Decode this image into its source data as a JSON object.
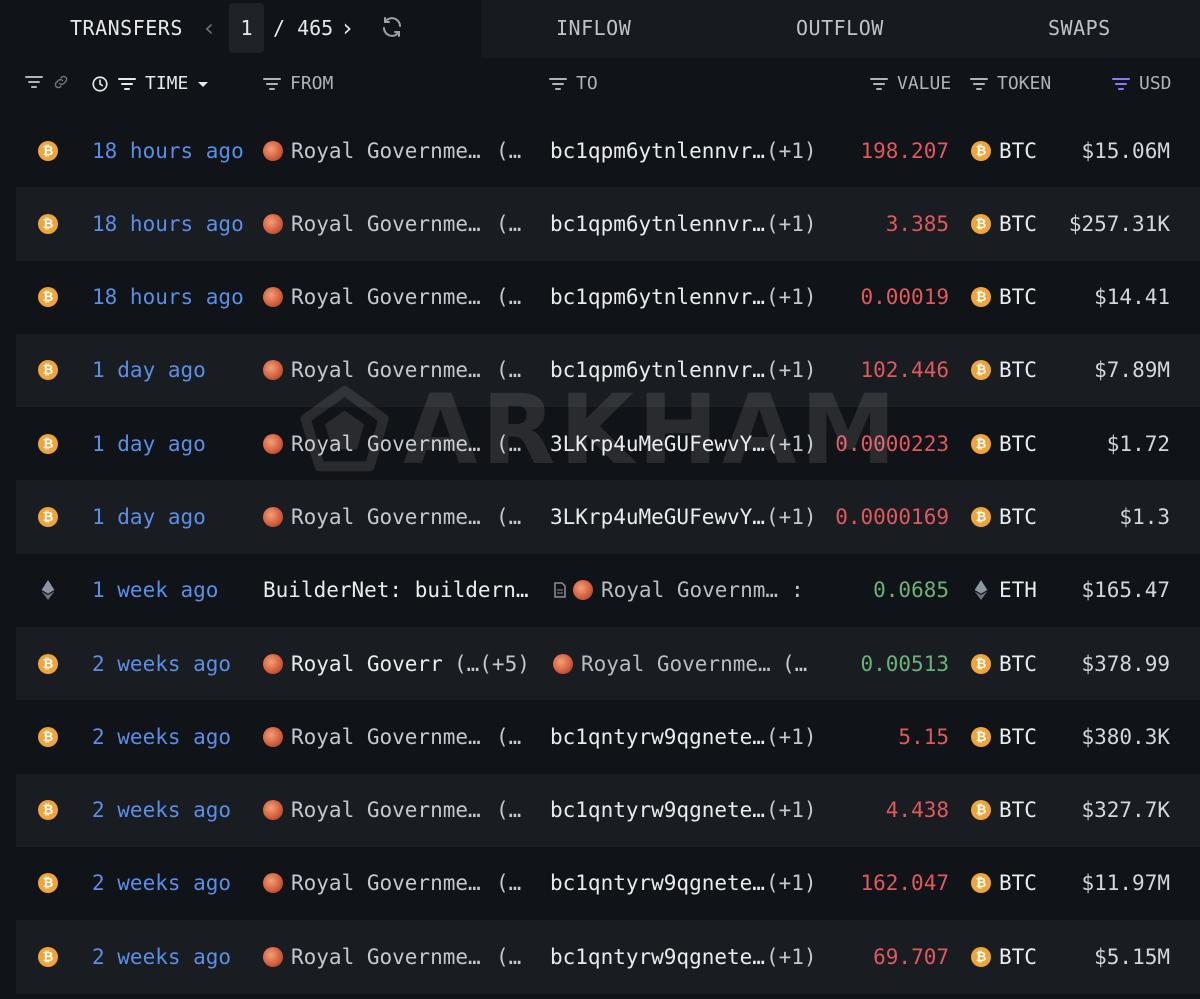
{
  "toolbar": {
    "title": "TRANSFERS",
    "page_current": "1",
    "page_total": "/ 465"
  },
  "tabs": [
    {
      "label": "INFLOW"
    },
    {
      "label": "OUTFLOW"
    },
    {
      "label": "SWAPS"
    }
  ],
  "columns": {
    "time": "TIME",
    "from": "FROM",
    "to": "TO",
    "value": "VALUE",
    "token": "TOKEN",
    "usd": "USD"
  },
  "watermark": "ARKHAM",
  "colors": {
    "negative": "#e0595d",
    "positive": "#6bb27a",
    "time_link": "#5b8ee6",
    "btc": "#f0a53a"
  },
  "rows": [
    {
      "chain": "btc",
      "time": "18 hours ago",
      "from": "Royal Governme…",
      "from_suffix": "(…",
      "to": "bc1qpm6ytnlennvr…",
      "to_suffix": "(+1)",
      "value": "198.207",
      "token": "BTC",
      "usd": "$15.06M"
    },
    {
      "chain": "btc",
      "time": "18 hours ago",
      "from": "Royal Governme…",
      "from_suffix": "(…",
      "to": "bc1qpm6ytnlennvr…",
      "to_suffix": "(+1)",
      "value": "3.385",
      "token": "BTC",
      "usd": "$257.31K"
    },
    {
      "chain": "btc",
      "time": "18 hours ago",
      "from": "Royal Governme…",
      "from_suffix": "(…",
      "to": "bc1qpm6ytnlennvr…",
      "to_suffix": "(+1)",
      "value": "0.00019",
      "token": "BTC",
      "usd": "$14.41"
    },
    {
      "chain": "btc",
      "time": "1 day ago",
      "from": "Royal Governme…",
      "from_suffix": "(…",
      "to": "bc1qpm6ytnlennvr…",
      "to_suffix": "(+1)",
      "value": "102.446",
      "token": "BTC",
      "usd": "$7.89M"
    },
    {
      "chain": "btc",
      "time": "1 day ago",
      "from": "Royal Governme…",
      "from_suffix": "(…",
      "to": "3LKrp4uMeGUFewvY…",
      "to_suffix": "(+1)",
      "value": "0.0000223",
      "token": "BTC",
      "usd": "$1.72"
    },
    {
      "chain": "btc",
      "time": "1 day ago",
      "from": "Royal Governme…",
      "from_suffix": "(…",
      "to": "3LKrp4uMeGUFewvY…",
      "to_suffix": "(+1)",
      "value": "0.0000169",
      "token": "BTC",
      "usd": "$1.3"
    },
    {
      "chain": "eth",
      "time": "1 week ago",
      "from": "BuilderNet: buildern…",
      "from_suffix": "",
      "to": "Royal Governm…",
      "to_suffix": ":",
      "value": "0.0685",
      "token": "ETH",
      "usd": "$165.47"
    },
    {
      "chain": "btc",
      "time": "2 weeks ago",
      "from": "Royal Goverr",
      "from_suffix": "(…(+5)",
      "to": "Royal Governme…",
      "to_suffix": "(…",
      "value": "0.00513",
      "token": "BTC",
      "usd": "$378.99"
    },
    {
      "chain": "btc",
      "time": "2 weeks ago",
      "from": "Royal Governme…",
      "from_suffix": "(…",
      "to": "bc1qntyrw9qgnete…",
      "to_suffix": "(+1)",
      "value": "5.15",
      "token": "BTC",
      "usd": "$380.3K"
    },
    {
      "chain": "btc",
      "time": "2 weeks ago",
      "from": "Royal Governme…",
      "from_suffix": "(…",
      "to": "bc1qntyrw9qgnete…",
      "to_suffix": "(+1)",
      "value": "4.438",
      "token": "BTC",
      "usd": "$327.7K"
    },
    {
      "chain": "btc",
      "time": "2 weeks ago",
      "from": "Royal Governme…",
      "from_suffix": "(…",
      "to": "bc1qntyrw9qgnete…",
      "to_suffix": "(+1)",
      "value": "162.047",
      "token": "BTC",
      "usd": "$11.97M"
    },
    {
      "chain": "btc",
      "time": "2 weeks ago",
      "from": "Royal Governme…",
      "from_suffix": "(…",
      "to": "bc1qntyrw9qgnete…",
      "to_suffix": "(+1)",
      "value": "69.707",
      "token": "BTC",
      "usd": "$5.15M"
    }
  ]
}
